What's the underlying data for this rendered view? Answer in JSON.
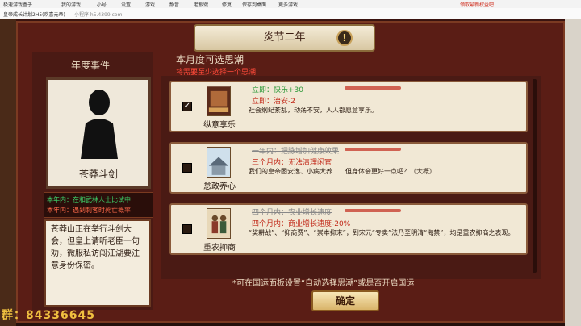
{
  "browser": {
    "tab_title": "皇帝成长计划2H5(欢喜元帝)",
    "items": [
      "极速游戏盒子",
      "我的游戏",
      "小号",
      "设置",
      "游戏",
      "静音",
      "老板键",
      "修复",
      "保存到桌面",
      "更多游戏"
    ],
    "url_hint": "小程序 h5.4399.com",
    "promo": "领取最新权益吧"
  },
  "game": {
    "title": "炎节二年",
    "warning_icon": "!",
    "left": {
      "heading": "年度事件",
      "name": "苍莽斗剑",
      "event_green": "本年内：在和武林人士比试中",
      "event_red": "本年内：遇到刺客时死亡概率",
      "description": "苍莽山正在举行斗剑大会，但皇上请听老臣一句劝，微服私访闯江湖要注意身份保密。"
    },
    "right": {
      "heading": "本月度可选思潮",
      "subheading": "将需要至少选择一个思潮",
      "cards": [
        {
          "checked": true,
          "label": "纵意享乐",
          "line1": "立即：快乐+30",
          "line2": "立即：治安-2",
          "desc": "社会纲纪紊乱，动荡不安，人人都愿意享乐。",
          "strike": false
        },
        {
          "checked": false,
          "label": "怠政养心",
          "line1": "一年内：把脉增加健康效果",
          "line2": "三个月内：无法清理闲官",
          "desc": "我们的皇帝图安逸、小病大养……但身体会更好一点吧？（大概）",
          "strike": true
        },
        {
          "checked": false,
          "label": "重农抑商",
          "line1": "四个月内：农业增长速度",
          "line2": "四个月内：商业增长速度-20%",
          "desc": "“奖耕战”、“抑商贾”、“崇本抑末”，到宋元“专卖”法乃至明清“海禁”，均是重农抑商之表现。",
          "strike": true
        }
      ]
    },
    "footer_note": "*可在国运面板设置“自动选择思潮”或是否开启国运",
    "confirm_button": "确定",
    "group_id": "群：84336645"
  }
}
